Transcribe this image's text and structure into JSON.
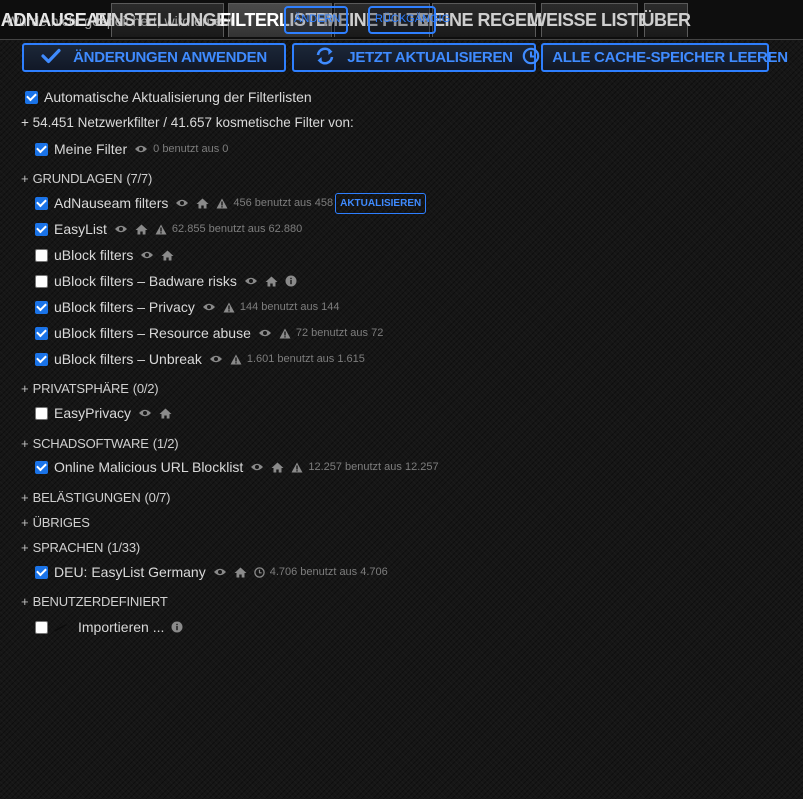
{
  "tabs": {
    "brand": "AdNauseam",
    "settings": "Einstellungen",
    "filterlists": "Filterlisten",
    "myfilters": "Meine Filter",
    "myrules": "Meine Regeln",
    "whitelist": "Weisse Liste",
    "about": "Über",
    "overlay_message": "Wurde nicht gespeichert, wird erneut",
    "ghost_label_1": "ÄNDERN",
    "ghost_label_2": "RÜCKGÄNGIG"
  },
  "actions": {
    "apply": "Änderungen anwenden",
    "update_now": "Jetzt aktualisieren",
    "purge_caches": "Alle Cache-Speicher leeren"
  },
  "auto_update": {
    "label": "Automatische Aktualisierung der Filterlisten",
    "checked": true
  },
  "summary": "+ 54.451 Netzwerkfilter / 41.657 kosmetische Filter von:",
  "my_filters": {
    "name": "Meine Filter",
    "checked": true,
    "stat": "0 benutzt aus 0"
  },
  "sections": {
    "basics": {
      "title": "Grundlagen",
      "count": "(7/7)"
    },
    "privacy": {
      "title": "Privatsphäre",
      "count": "(0/2)"
    },
    "malware": {
      "title": "Schadsoftware",
      "count": "(1/2)"
    },
    "annoyances": {
      "title": "Belästigungen",
      "count": "(0/7)"
    },
    "misc": {
      "title": "Übriges",
      "count": ""
    },
    "languages": {
      "title": "Sprachen",
      "count": "(1/33)"
    },
    "custom": {
      "title": "Benutzerdefiniert",
      "count": ""
    }
  },
  "lists": {
    "adnauseam": {
      "name": "AdNauseam filters",
      "checked": true,
      "stat": "456 benutzt aus 458",
      "update_label": "aktualisieren"
    },
    "easylist": {
      "name": "EasyList",
      "checked": true,
      "stat": "62.855 benutzt aus 62.880"
    },
    "ublock": {
      "name": "uBlock filters",
      "checked": false
    },
    "ublock_badware": {
      "name": "uBlock filters – Badware risks",
      "checked": false
    },
    "ublock_privacy": {
      "name": "uBlock filters – Privacy",
      "checked": true,
      "stat": "144 benutzt aus 144"
    },
    "ublock_resource": {
      "name": "uBlock filters – Resource abuse",
      "checked": true,
      "stat": "72 benutzt aus 72"
    },
    "ublock_unbreak": {
      "name": "uBlock filters – Unbreak",
      "checked": true,
      "stat": "1.601 benutzt aus 1.615"
    },
    "easyprivacy": {
      "name": "EasyPrivacy",
      "checked": false
    },
    "malicious_url": {
      "name": "Online Malicious URL Blocklist",
      "checked": true,
      "stat": "12.257 benutzt aus 12.257"
    },
    "deu_easylist": {
      "name": "DEU: EasyList Germany",
      "checked": true,
      "stat": "4.706 benutzt aus 4.706"
    },
    "import": {
      "name": "Importieren ...",
      "checked": false
    }
  },
  "colors": {
    "accent": "#2e7fff",
    "checkbox": "#1a73e8",
    "background": "#161616"
  },
  "icons": [
    "check-icon",
    "refresh-icon",
    "clock-icon",
    "eye-icon",
    "home-icon",
    "warning-icon",
    "info-icon",
    "pen-icon"
  ]
}
